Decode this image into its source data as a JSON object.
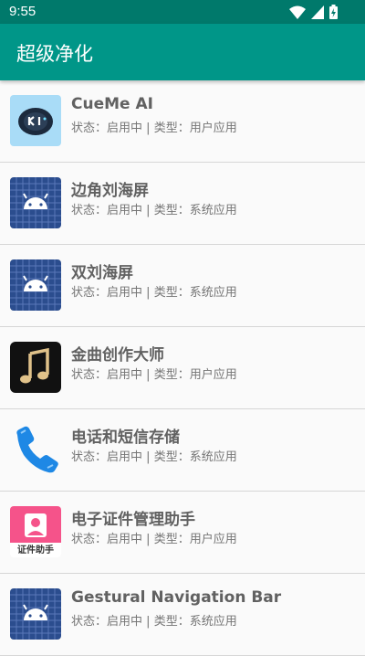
{
  "status_bar": {
    "time": "9:55",
    "icons": [
      "wifi-icon",
      "signal-icon",
      "battery-charging-icon"
    ]
  },
  "app_bar": {
    "title": "超级净化"
  },
  "apps": [
    {
      "name": "CueMe AI",
      "status_label": "状态：",
      "status": "启用中",
      "separator": " | ",
      "type_label": "类型：",
      "type": "用户应用",
      "icon": "cueme-ai-icon"
    },
    {
      "name": "边角刘海屏",
      "status_label": "状态：",
      "status": "启用中",
      "separator": " | ",
      "type_label": "类型：",
      "type": "系统应用",
      "icon": "android-default-icon"
    },
    {
      "name": "双刘海屏",
      "status_label": "状态：",
      "status": "启用中",
      "separator": " | ",
      "type_label": "类型：",
      "type": "系统应用",
      "icon": "android-default-icon"
    },
    {
      "name": "金曲创作大师",
      "status_label": "状态：",
      "status": "启用中",
      "separator": " | ",
      "type_label": "类型：",
      "type": "用户应用",
      "icon": "music-note-icon"
    },
    {
      "name": "电话和短信存储",
      "status_label": "状态：",
      "status": "启用中",
      "separator": " | ",
      "type_label": "类型：",
      "type": "系统应用",
      "icon": "phone-icon"
    },
    {
      "name": "电子证件管理助手",
      "status_label": "状态：",
      "status": "启用中",
      "separator": " | ",
      "type_label": "类型：",
      "type": "用户应用",
      "icon": "id-photo-icon",
      "icon_text": "证件助手"
    },
    {
      "name": "Gestural Navigation Bar",
      "status_label": "状态：",
      "status": "启用中",
      "separator": " | ",
      "type_label": "类型：",
      "type": "系统应用",
      "icon": "android-default-icon"
    }
  ],
  "colors": {
    "status_bar": "#00796b",
    "app_bar": "#009688",
    "background": "#fafafa",
    "title_text": "#616161",
    "meta_text": "#757575"
  }
}
